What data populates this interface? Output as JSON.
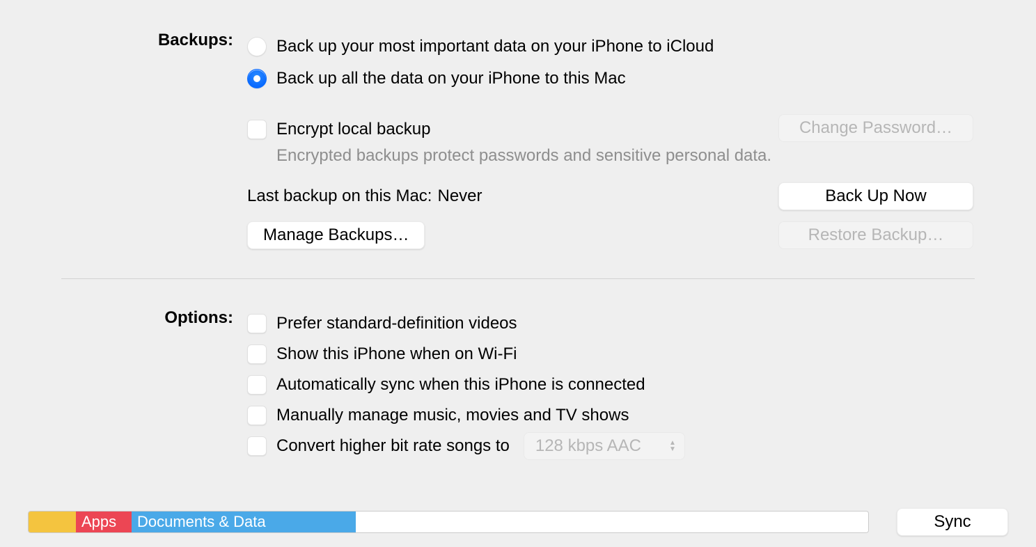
{
  "backups": {
    "label": "Backups:",
    "radio_icloud": "Back up your most important data on your iPhone to iCloud",
    "radio_mac": "Back up all the data on your iPhone to this Mac",
    "encrypt_label": "Encrypt local backup",
    "encrypt_hint": "Encrypted backups protect passwords and sensitive personal data.",
    "change_password_btn": "Change Password…",
    "last_backup_label": "Last backup on this Mac:",
    "last_backup_value": "Never",
    "backup_now_btn": "Back Up Now",
    "manage_backups_btn": "Manage Backups…",
    "restore_backup_btn": "Restore Backup…"
  },
  "options": {
    "label": "Options:",
    "items": [
      "Prefer standard-definition videos",
      "Show this iPhone when on Wi-Fi",
      "Automatically sync when this iPhone is connected",
      "Manually manage music, movies and TV shows",
      "Convert higher bit rate songs to"
    ],
    "bitrate_value": "128 kbps AAC"
  },
  "storage": {
    "apps_label": "Apps",
    "docs_label": "Documents & Data"
  },
  "sync_btn": "Sync"
}
